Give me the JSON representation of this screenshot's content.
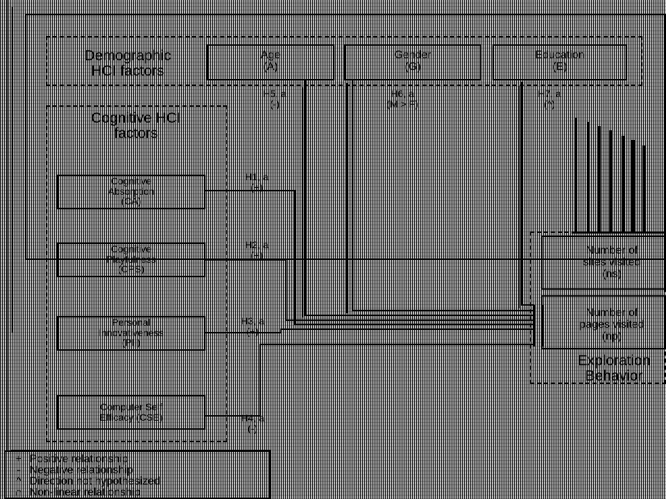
{
  "demographic": {
    "title": "Demographic\nHCI factors",
    "age": "Age\n(A)",
    "gender": "Gender\n(G)",
    "education": "Education\n(E)"
  },
  "cognitive": {
    "title": "Cognitive HCI\nfactors",
    "ca": "Cognitive\nAbsorption\n(CA)",
    "cps": "Cognitive\nPlayfulness\n(CPS)",
    "pii": "Personal\nInnovativeness\n(PII)",
    "cse": "Computer Self\nEfficacy (CSE)"
  },
  "hypotheses": {
    "h1": "H1, a\n(+)",
    "h2": "H2, a\n(+)",
    "h3": "H3, a\n(+)",
    "h4": "H4, a\n(-)",
    "h5": "H5, a\n(-)",
    "h6": "H6, a\n(M > F)",
    "h7": "H7, a\n(^)"
  },
  "outcomes": {
    "ns": "Number of\nsites visited\n(ns)",
    "np": "Number of\npages visited\n(np)",
    "exploration": "Exploration\nBehavior"
  },
  "legend": {
    "items": [
      {
        "symbol": "+",
        "text": "Positive relationship"
      },
      {
        "symbol": "-",
        "text": "Negative relationship"
      },
      {
        "symbol": "^",
        "text": "Direction not hypothesized"
      },
      {
        "symbol": "∩",
        "text": "Non-linear relationship"
      }
    ]
  }
}
